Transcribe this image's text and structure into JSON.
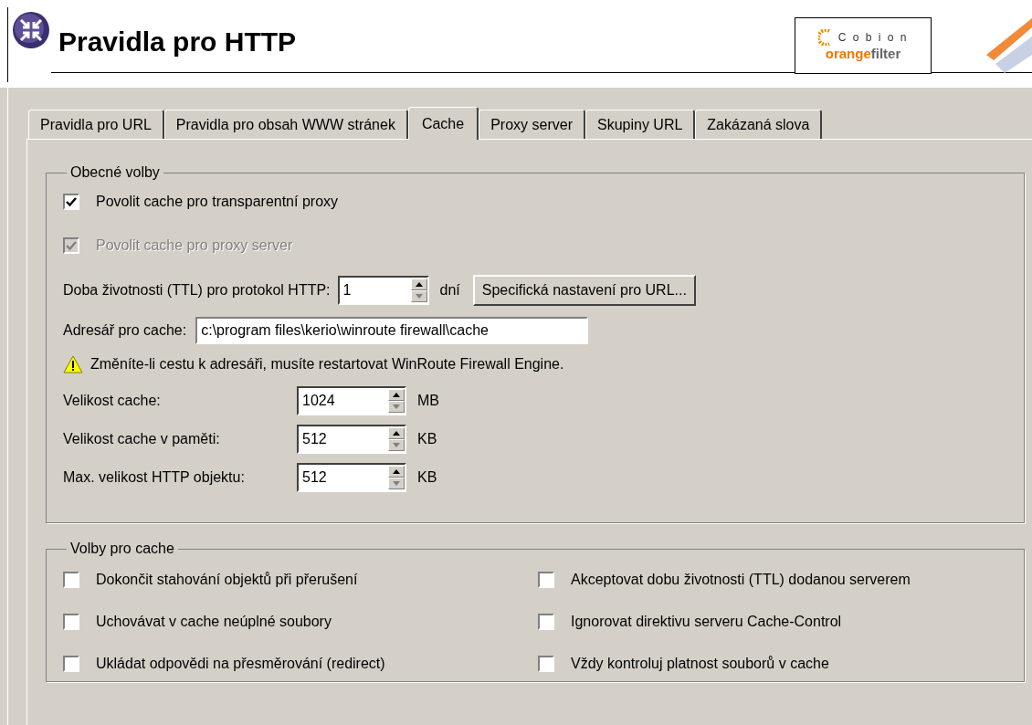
{
  "header": {
    "title": "Pravidla pro HTTP",
    "logo": {
      "top": "C o b i o n",
      "brand_first": "orange",
      "brand_second": "filter"
    }
  },
  "tabs": [
    {
      "label": "Pravidla pro URL",
      "selected": false
    },
    {
      "label": "Pravidla pro obsah WWW stránek",
      "selected": false
    },
    {
      "label": "Cache",
      "selected": true
    },
    {
      "label": "Proxy server",
      "selected": false
    },
    {
      "label": "Skupiny URL",
      "selected": false
    },
    {
      "label": "Zakázaná slova",
      "selected": false
    }
  ],
  "general": {
    "title": "Obecné volby",
    "checkboxes": [
      {
        "label": "Povolit cache pro transparentní proxy",
        "checked": true,
        "disabled": false
      },
      {
        "label": "Povolit cache pro proxy server",
        "checked": true,
        "disabled": true
      }
    ],
    "ttl": {
      "label": "Doba životnosti (TTL) pro protokol HTTP:",
      "value": "1",
      "unit": "dní",
      "button": "Specifická nastavení pro URL..."
    },
    "directory": {
      "label": "Adresář pro cache:",
      "value": "c:\\program files\\kerio\\winroute firewall\\cache"
    },
    "warning": "Změníte-li cestu k adresáři, musíte restartovat WinRoute Firewall Engine.",
    "sizes": [
      {
        "label": "Velikost cache:",
        "value": "1024",
        "unit": "MB"
      },
      {
        "label": "Velikost cache v paměti:",
        "value": "512",
        "unit": "KB"
      },
      {
        "label": "Max. velikost HTTP objektu:",
        "value": "512",
        "unit": "KB"
      }
    ]
  },
  "cache_options": {
    "title": "Volby pro cache",
    "checkboxes": [
      {
        "label": "Dokončit stahování objektů při přerušení",
        "checked": false
      },
      {
        "label": "Akceptovat dobu životnosti (TTL) dodanou serverem",
        "checked": false
      },
      {
        "label": "Uchovávat v cache neúplné soubory",
        "checked": false
      },
      {
        "label": "Ignorovat direktivu serveru Cache-Control",
        "checked": false
      },
      {
        "label": "Ukládat odpovědi na přesměrování (redirect)",
        "checked": false
      },
      {
        "label": "Vždy kontroluj platnost souborů v cache",
        "checked": false
      }
    ]
  }
}
